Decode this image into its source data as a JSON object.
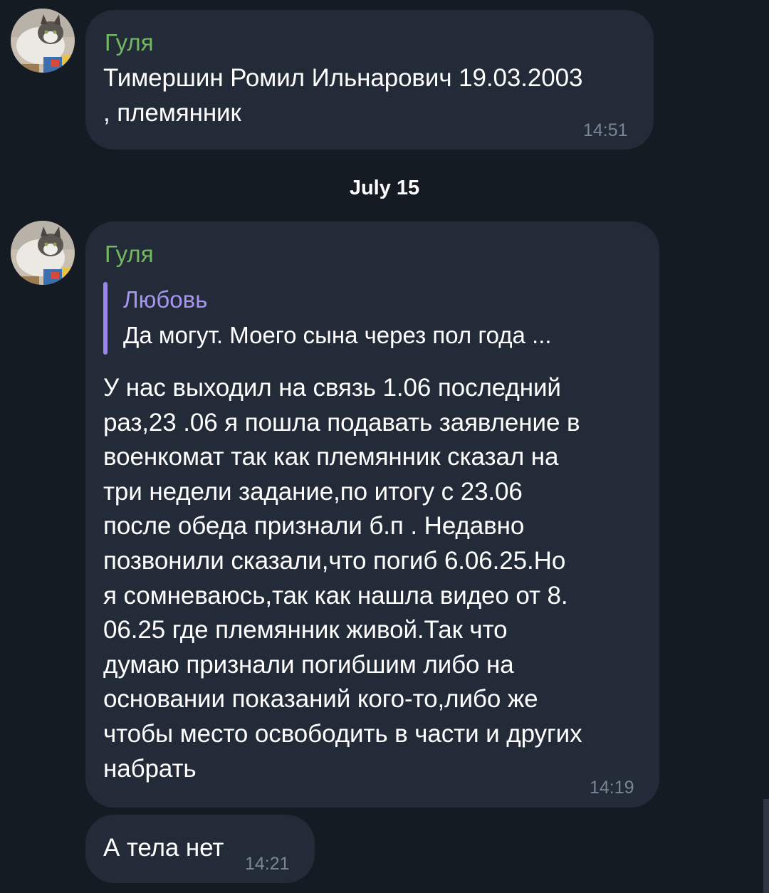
{
  "messages": [
    {
      "sender": "Гуля",
      "text": "Тимершин Ромил Ильнарович 19.03.2003\n, племянник",
      "time": "14:51"
    },
    {
      "sender": "Гуля",
      "reply": {
        "name": "Любовь",
        "text": "Да могут. Моего сына через пол года ..."
      },
      "text": "У нас выходил на связь 1.06 последний\nраз,23 .06 я пошла подавать заявление в\nвоенкомат так как племянник сказал на\nтри недели задание,по итогу с 23.06\nпосле обеда признали б.п . Недавно\nпозвонили сказали,что погиб 6.06.25.Но\nя сомневаюсь,так как нашла видео от 8.\n06.25 где племянник живой.Так что\nдумаю признали погибшим либо на\nосновании показаний кого-то,либо же\nчтобы место освободить в части и других\nнабрать",
      "time": "14:19"
    },
    {
      "text": "А тела нет",
      "time": "14:21"
    }
  ],
  "date_separator": "July 15",
  "colors": {
    "background": "#151b23",
    "bubble": "#222b37",
    "sender_name": "#72b961",
    "reply_name": "#a694f0",
    "reply_bar": "#9a86e6",
    "timestamp": "#7a8694"
  }
}
